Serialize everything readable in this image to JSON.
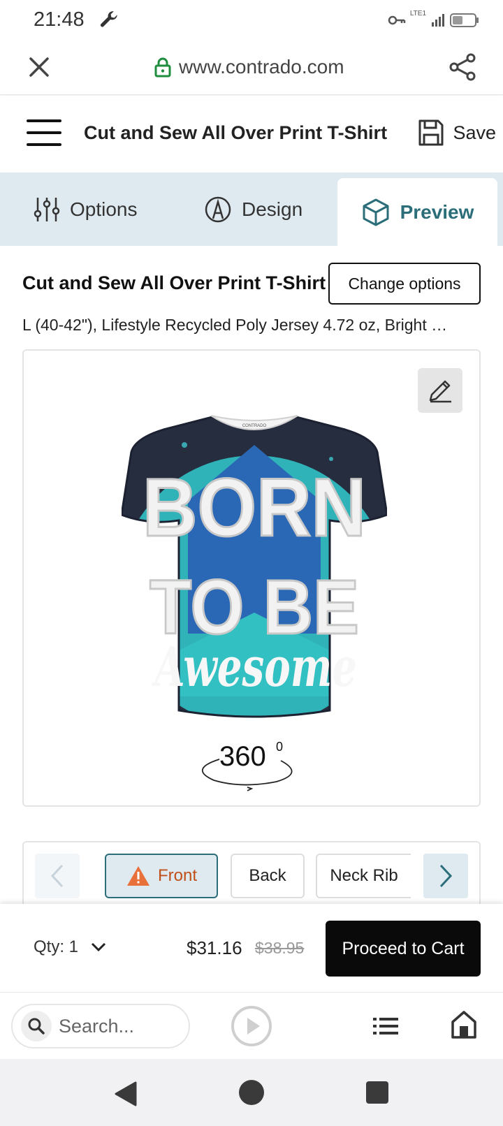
{
  "status_bar": {
    "time": "21:48",
    "network": "LTE",
    "sim": "1",
    "icons": [
      "wrench-icon",
      "key-icon",
      "signal-icon",
      "battery-icon"
    ]
  },
  "browser": {
    "url": "www.contrado.com",
    "icons": [
      "close-icon",
      "lock-icon",
      "share-icon"
    ],
    "bottom": {
      "search_placeholder": "Search...",
      "icons": [
        "search-icon",
        "play-icon",
        "list-icon",
        "home-icon"
      ]
    }
  },
  "header": {
    "title": "Cut and Sew All Over Print T-Shirt",
    "save_label": "Save"
  },
  "tabs": [
    {
      "label": "Options",
      "icon": "sliders-icon",
      "active": false
    },
    {
      "label": "Design",
      "icon": "pencil-circle-icon",
      "active": false
    },
    {
      "label": "Preview",
      "icon": "cube-icon",
      "active": true
    }
  ],
  "product": {
    "title": "Cut and Sew All Over Print T-Shirt",
    "change_options_label": "Change options",
    "description": "L (40-42\"), Lifestyle Recycled Poly Jersey 4.72 oz, Bright …"
  },
  "preview": {
    "shirt_text": [
      "BORN",
      "TO BE",
      "Awesome"
    ],
    "collar_label": "CONTRADO",
    "rotate_label": "360",
    "rotate_sup": "0"
  },
  "views": {
    "items": [
      {
        "label": "Front",
        "active": true,
        "warning": true
      },
      {
        "label": "Back",
        "active": false
      },
      {
        "label": "Neck Rib",
        "active": false
      }
    ]
  },
  "cart": {
    "qty_label": "Qty: 1",
    "price": "$31.16",
    "old_price": "$38.95",
    "proceed_label": "Proceed to Cart"
  },
  "colors": {
    "accent": "#2b6e7a",
    "tab_bg": "#dfeaf0",
    "warning": "#e8703a",
    "shirt_dark": "#262d3f",
    "shirt_teal": "#2fb3b8",
    "shirt_blue": "#2a67b5"
  }
}
